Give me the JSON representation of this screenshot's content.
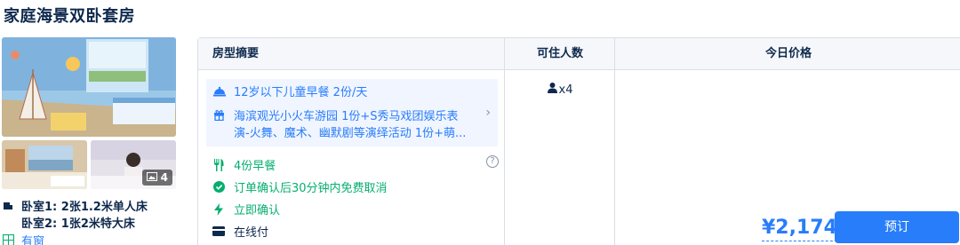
{
  "room": {
    "title": "家庭海景双卧套房",
    "photo_count": "4",
    "beds": [
      {
        "label": "卧室1:  2张1.2米单人床"
      },
      {
        "label": "卧室2:  1张2米特大床"
      }
    ],
    "window": "有窗"
  },
  "table": {
    "headers": [
      "房型摘要",
      "可住人数",
      "今日价格"
    ]
  },
  "perks": [
    {
      "icon": "breakfast-dome-icon",
      "text": "12岁以下儿童早餐 2份/天"
    },
    {
      "icon": "gift-icon",
      "text": "海滨观光小火车游园 1份+S秀马戏团娱乐表演-火舞、魔术、幽默剧等演绎活动 1份+萌..."
    }
  ],
  "features": [
    {
      "icon": "fork-knife-icon",
      "text": "4份早餐"
    },
    {
      "icon": "check-circle-icon",
      "text": "订单确认后30分钟内免费取消"
    },
    {
      "icon": "lightning-icon",
      "text": "立即确认"
    },
    {
      "icon": "credit-card-icon",
      "text": "在线付"
    }
  ],
  "occupancy": "x4",
  "price": "¥2,174",
  "book_label": "预订",
  "colors": {
    "accent": "#287dfa",
    "green": "#06ae6f",
    "text": "#0f294d",
    "perk_bg": "#f0f5ff",
    "header_bg": "#f5f7fa"
  }
}
